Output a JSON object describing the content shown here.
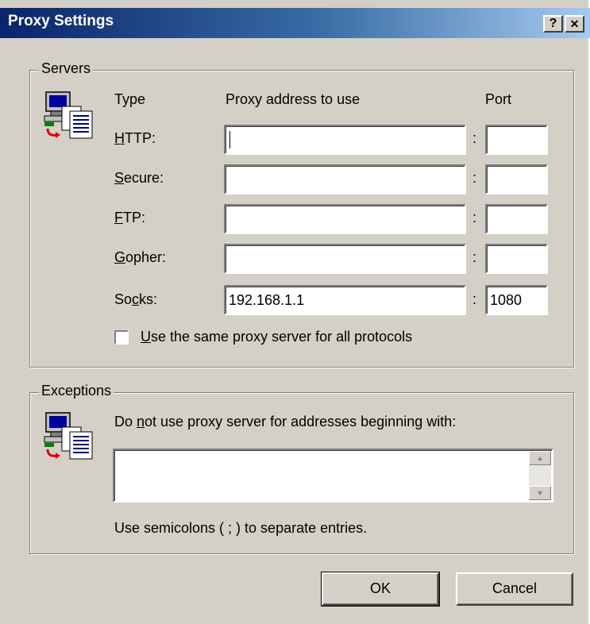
{
  "window": {
    "title": "Proxy Settings",
    "help_glyph": "?",
    "close_glyph": "✕"
  },
  "servers": {
    "group_label": "Servers",
    "icon": "network-computer-icon",
    "col_type": "Type",
    "col_address": "Proxy address to use",
    "col_port": "Port",
    "separator": ":",
    "rows": [
      {
        "key": "H",
        "rest": "TTP:",
        "address": "",
        "port": ""
      },
      {
        "key": "S",
        "rest": "ecure:",
        "address": "",
        "port": ""
      },
      {
        "key": "F",
        "rest": "TP:",
        "address": "",
        "port": ""
      },
      {
        "key": "G",
        "rest": "opher:",
        "address": "",
        "port": ""
      },
      {
        "pre": "So",
        "key": "c",
        "rest": "ks:",
        "address": "192.168.1.1",
        "port": "1080"
      }
    ],
    "same_proxy": {
      "key": "U",
      "rest": "se the same proxy server for all protocols",
      "checked": false
    }
  },
  "exceptions": {
    "group_label": "Exceptions",
    "icon": "network-computer-icon",
    "desc_pre": "Do ",
    "desc_key": "n",
    "desc_rest": "ot use proxy server for addresses beginning with:",
    "value": "",
    "hint": "Use semicolons ( ; ) to separate entries."
  },
  "buttons": {
    "ok": "OK",
    "cancel": "Cancel"
  },
  "colors": {
    "title_start": "#0a246a",
    "title_end": "#a6caf0",
    "face": "#d4d0c8"
  }
}
